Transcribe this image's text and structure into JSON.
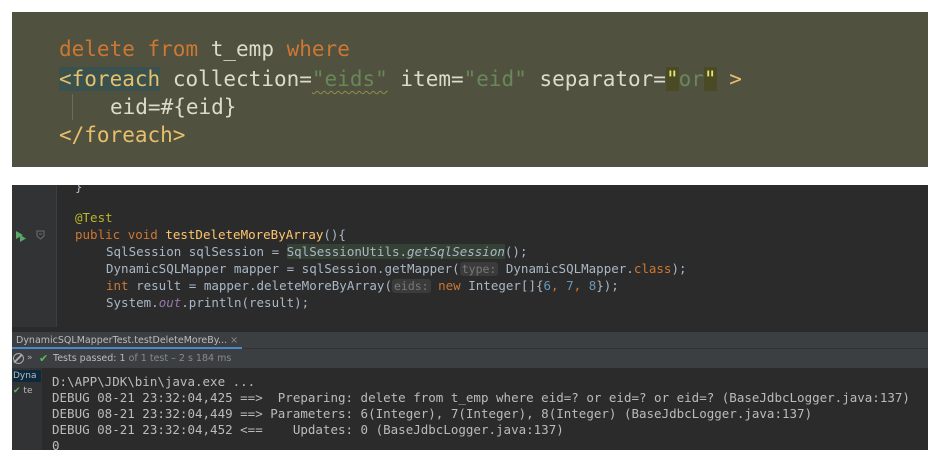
{
  "xml_snippet": {
    "line1": {
      "kw_delete": "delete",
      "kw_from": "from",
      "table": "t_emp",
      "kw_where": "where"
    },
    "line2": {
      "tag_open": "<foreach",
      "attr_collection": "collection=",
      "val_collection": "\"eids\"",
      "attr_item": "item=",
      "val_item": "\"eid\"",
      "attr_separator": "separator=",
      "quote_open": "\"",
      "val_separator": "or",
      "quote_close": "\"",
      "tag_end": ">"
    },
    "line3": "eid=#{eid}",
    "line4": "</foreach>"
  },
  "code_editor": {
    "line0": "}",
    "annotation": "@Test",
    "sig": {
      "kw_public": "public",
      "kw_void": "void",
      "method": "testDeleteMoreByArray",
      "rest": "(){"
    },
    "line3": {
      "type": "SqlSession sqlSession = ",
      "call_hl": "SqlSessionUtils.",
      "static_call": "getSqlSession",
      "rest": "();"
    },
    "line4": {
      "start": "DynamicSQLMapper mapper = sqlSession.getMapper(",
      "hint": "type:",
      "arg": " DynamicSQLMapper.",
      "kw_class": "class",
      "end": ");"
    },
    "line5": {
      "kw_int": "int",
      "mid": " result = mapper.deleteMoreByArray(",
      "hint": "eids:",
      "kw_new": " new",
      "type": " Integer[]{",
      "n1": "6",
      "c1": ", ",
      "n2": "7",
      "c2": ", ",
      "n3": "8",
      "end": "});"
    },
    "line6": {
      "start": "System.",
      "field": "out",
      "end": ".println(result);"
    }
  },
  "run_window": {
    "tab_label": "DynamicSQLMapperTest.testDeleteMoreBy...",
    "tab_close": "×",
    "status": {
      "passed_label": "Tests passed:",
      "passed_count": "1",
      "detail": "of 1 test – 2 s 184 ms"
    },
    "side_items": [
      "Dyna",
      "te"
    ],
    "console": [
      "D:\\APP\\JDK\\bin\\java.exe ...",
      "DEBUG 08-21 23:32:04,425 ==>  Preparing: delete from t_emp where eid=? or eid=? or eid=? (BaseJdbcLogger.java:137)",
      "DEBUG 08-21 23:32:04,449 ==> Parameters: 6(Integer), 7(Integer), 8(Integer) (BaseJdbcLogger.java:137)",
      "DEBUG 08-21 23:32:04,452 <==    Updates: 0 (BaseJdbcLogger.java:137)",
      "0"
    ]
  },
  "icons": {
    "run_gutter": "run-test-icon",
    "fold": "fold-icon",
    "stop": "stop-icon",
    "passed": "check-icon"
  },
  "colors": {
    "xml_bg": "#515140",
    "ide_bg": "#2b2b2b",
    "keyword": "#cc7832",
    "string": "#6a8759",
    "pass_green": "#5fb85f"
  }
}
